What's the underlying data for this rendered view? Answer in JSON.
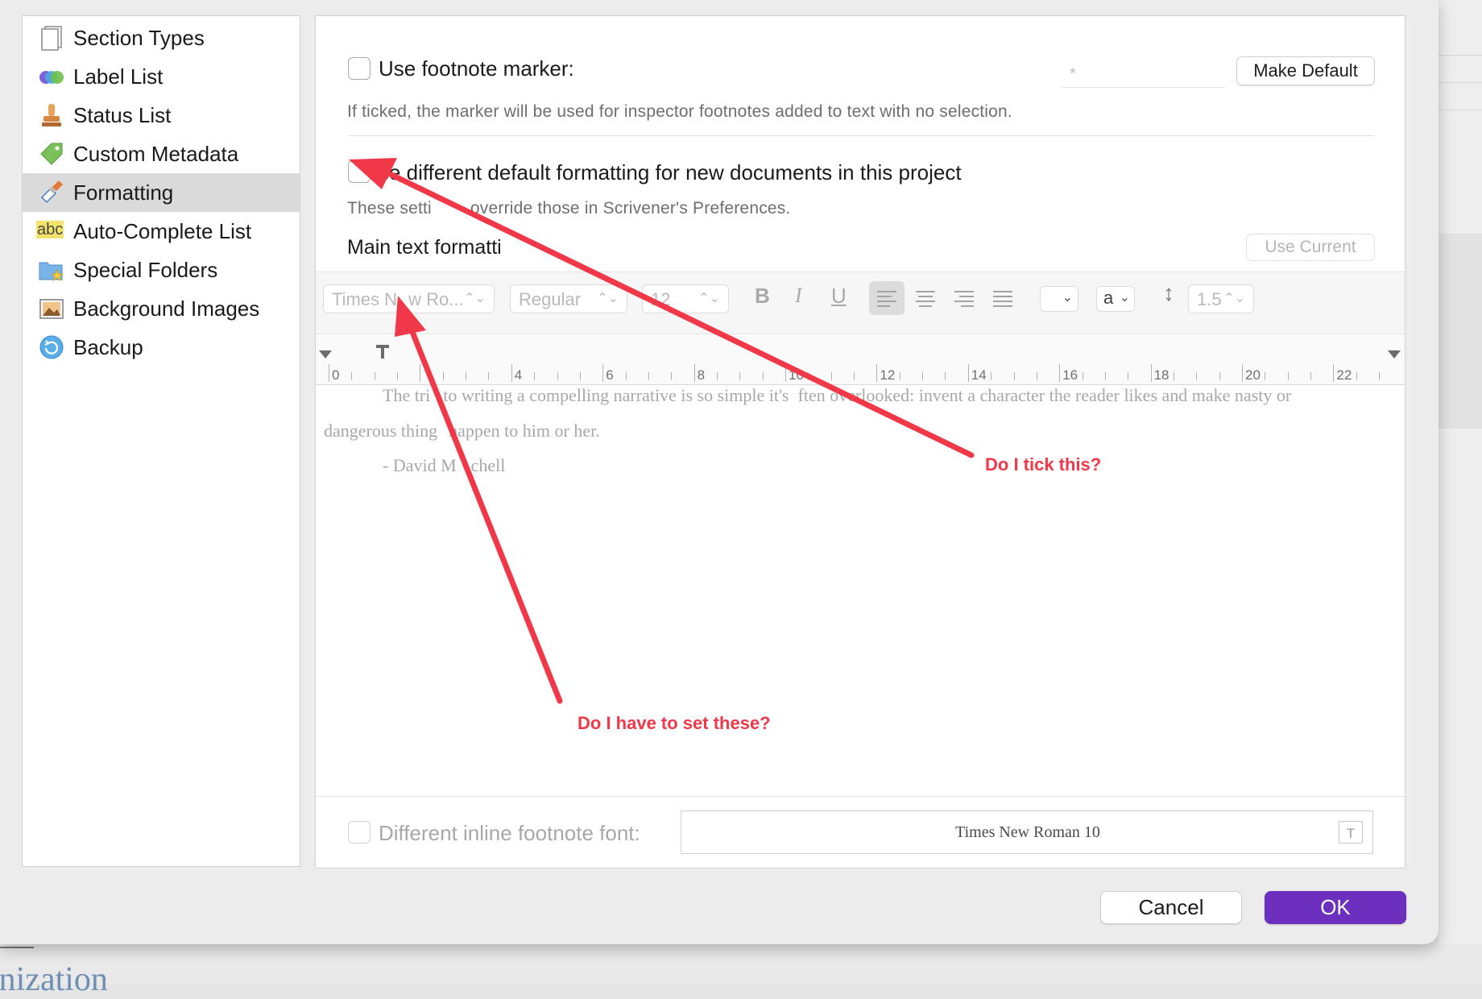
{
  "sidebar": {
    "items": [
      {
        "label": "Section Types",
        "icon": "section-types-icon"
      },
      {
        "label": "Label List",
        "icon": "label-list-icon"
      },
      {
        "label": "Status List",
        "icon": "status-stamp-icon"
      },
      {
        "label": "Custom Metadata",
        "icon": "tag-icon"
      },
      {
        "label": "Formatting",
        "icon": "paintbrush-icon",
        "selected": true
      },
      {
        "label": "Auto-Complete List",
        "icon": "abc-icon",
        "icon_text": "abc"
      },
      {
        "label": "Special Folders",
        "icon": "special-folder-icon"
      },
      {
        "label": "Background Images",
        "icon": "image-icon"
      },
      {
        "label": "Backup",
        "icon": "backup-icon"
      }
    ]
  },
  "panel": {
    "footnote_marker_label": "Use footnote marker:",
    "footnote_marker_value": "*",
    "make_default_label": "Make Default",
    "footnote_help": "If ticked, the marker will be used for inspector footnotes added to text with no selection.",
    "different_formatting_label": "se different default formatting for new documents in this project",
    "different_formatting_help_a": "These setti",
    "different_formatting_help_b": "override those in Scrivener's Preferences.",
    "main_text_formatting_label": "Main text formatti",
    "use_current_label": "Use Current",
    "toolbar": {
      "font_family": "Times N",
      "font_family_tail": "w Ro...",
      "font_style": "Regular",
      "font_size": "12",
      "bold": "B",
      "italic": "I",
      "underline": "U",
      "text_color_label": "a",
      "line_spacing": "1.5"
    },
    "ruler_numbers": [
      "0",
      "4",
      "6",
      "8",
      "10",
      "12",
      "14",
      "16",
      "18",
      "20",
      "22"
    ],
    "sample": {
      "line1_a": "The tri",
      "line1_b": "to writing a compelling narrative is so simple it's",
      "line1_c": "ften overlooked: invent a character the reader likes and make nasty or",
      "line2_a": "dangerous thing",
      "line2_b": "happen to him or her.",
      "line3_a": "- David M",
      "line3_b": "chell"
    },
    "inline_footnote_label": "Different inline footnote font:",
    "inline_footnote_font": "Times New Roman 10"
  },
  "buttons": {
    "cancel": "Cancel",
    "ok": "OK"
  },
  "annotations": {
    "q1": "Do I tick this?",
    "q2": "Do I have to set these?",
    "color": "#f03848"
  },
  "background": {
    "partial_text": "anization"
  }
}
